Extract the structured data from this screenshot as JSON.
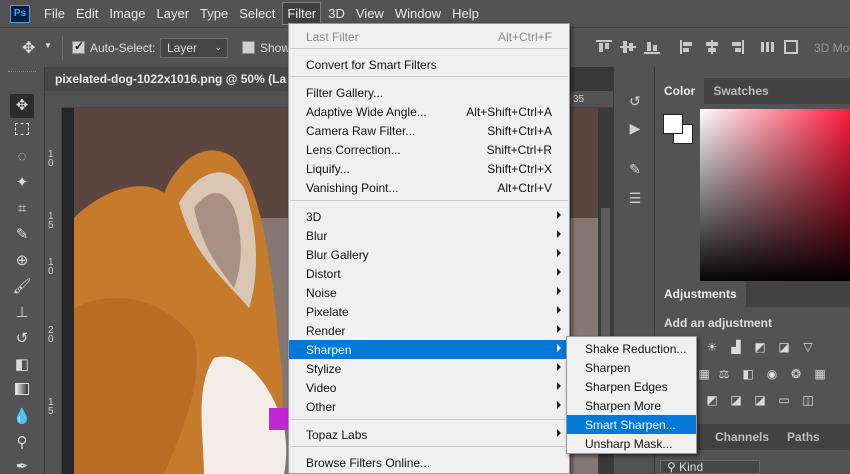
{
  "app": {
    "logo_text": "Ps"
  },
  "menubar": [
    "File",
    "Edit",
    "Image",
    "Layer",
    "Type",
    "Select",
    "Filter",
    "3D",
    "View",
    "Window",
    "Help"
  ],
  "options_bar": {
    "auto_select_label": "Auto-Select:",
    "auto_select_checked": true,
    "auto_select_value": "Layer",
    "show_label": "Show",
    "mode_3d_label": "3D Mo"
  },
  "document": {
    "tab_title": "pixelated-dog-1022x1016.png @ 50% (La"
  },
  "rulers": {
    "top": [
      "35"
    ],
    "left": [
      "1 0",
      "1 5",
      "1 0",
      "2 0",
      "1 5"
    ]
  },
  "filter_menu": {
    "last_filter": {
      "label": "Last Filter",
      "shortcut": "Alt+Ctrl+F"
    },
    "convert": "Convert for Smart Filters",
    "group1": [
      {
        "label": "Filter Gallery...",
        "shortcut": ""
      },
      {
        "label": "Adaptive Wide Angle...",
        "shortcut": "Alt+Shift+Ctrl+A"
      },
      {
        "label": "Camera Raw Filter...",
        "shortcut": "Shift+Ctrl+A"
      },
      {
        "label": "Lens Correction...",
        "shortcut": "Shift+Ctrl+R"
      },
      {
        "label": "Liquify...",
        "shortcut": "Shift+Ctrl+X"
      },
      {
        "label": "Vanishing Point...",
        "shortcut": "Alt+Ctrl+V"
      }
    ],
    "group2": [
      "3D",
      "Blur",
      "Blur Gallery",
      "Distort",
      "Noise",
      "Pixelate",
      "Render",
      "Sharpen",
      "Stylize",
      "Video",
      "Other"
    ],
    "highlighted": "Sharpen",
    "topaz": "Topaz Labs",
    "browse": "Browse Filters Online..."
  },
  "sharpen_submenu": {
    "items": [
      "Shake Reduction...",
      "Sharpen",
      "Sharpen Edges",
      "Sharpen More",
      "Smart Sharpen...",
      "Unsharp Mask..."
    ],
    "highlighted": "Smart Sharpen..."
  },
  "panels": {
    "color_tabs": [
      "Color",
      "Swatches"
    ],
    "adjustments_tab": "Adjustments",
    "adjustments_hint": "Add an adjustment",
    "layers_tabs": [
      "Channels",
      "Paths"
    ],
    "kind_label": "Kind"
  }
}
